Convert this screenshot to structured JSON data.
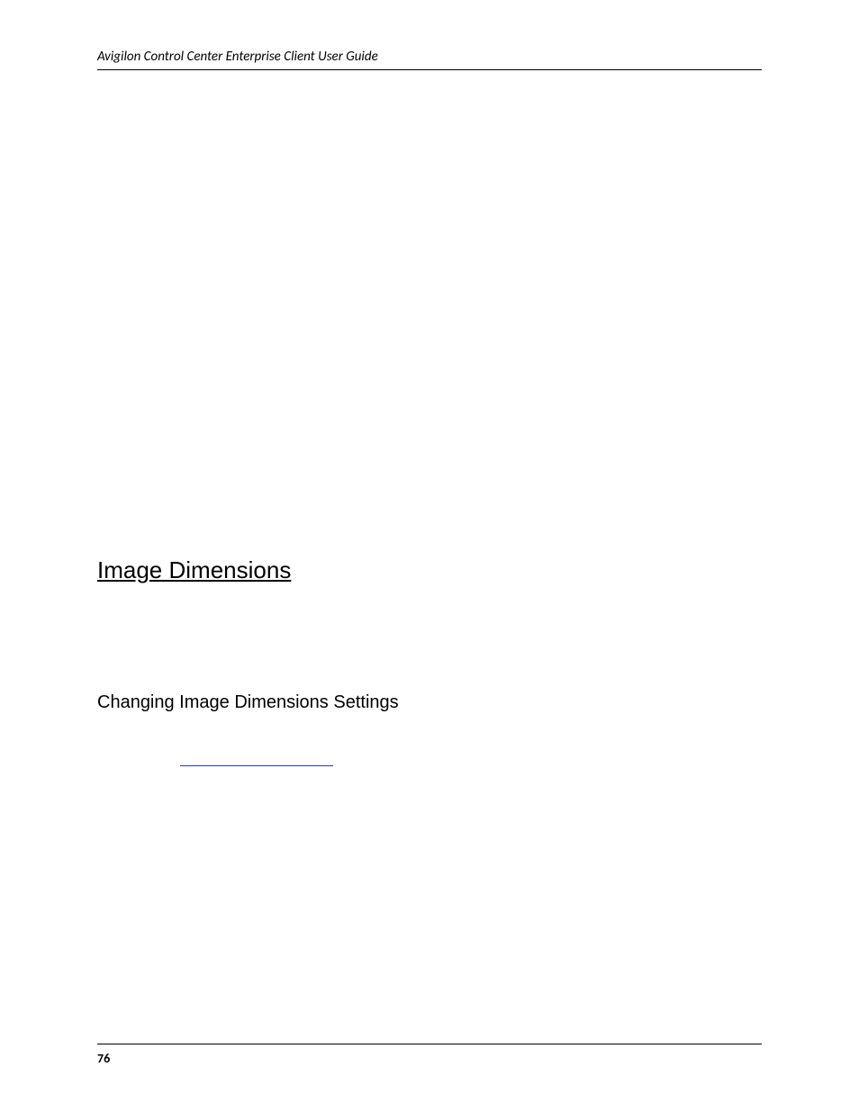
{
  "header": {
    "title": "Avigilon Control Center Enterprise Client User Guide"
  },
  "section": {
    "heading": "Image Dimensions",
    "sub_heading": "Changing Image Dimensions Settings"
  },
  "footer": {
    "page_number": "76"
  }
}
